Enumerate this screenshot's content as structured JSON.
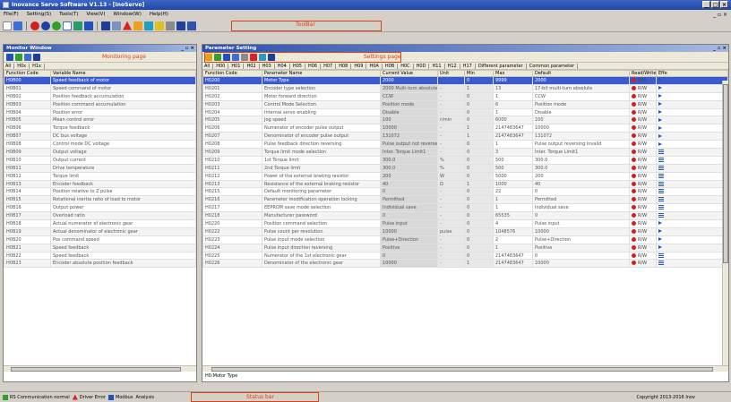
{
  "window": {
    "title": "Inovance Servo Software  V1.13  -  [InoServo]",
    "controls": [
      "_",
      "□",
      "×"
    ]
  },
  "menu": [
    "File(F)",
    "Setting(S)",
    "Tools(T)",
    "View(V)",
    "Window(W)",
    "Help(H)"
  ],
  "toolbar": {
    "annotation": "ToolBar",
    "icons": [
      "new-icon",
      "open-icon",
      "save-icon",
      "connect-icon",
      "disconnect-icon",
      "monitor-icon",
      "oscilloscope-icon",
      "trend-icon",
      "inertia-icon",
      "gain-icon",
      "alarm-icon",
      "jog-icon",
      "tune-icon",
      "io-icon",
      "compare-icon",
      "print-icon",
      "help-icon"
    ]
  },
  "left_panel": {
    "title": "Monitor Window",
    "annotation": "Monitoring page",
    "filter_tabs": [
      "All",
      "H0x",
      "H1x"
    ],
    "columns": [
      "Function Code",
      "Variable Name"
    ],
    "rows": [
      [
        "H0B00",
        "Speed feedback of motor"
      ],
      [
        "H0B01",
        "Speed command of motor"
      ],
      [
        "H0B02",
        "Position feedback accumulation"
      ],
      [
        "H0B03",
        "Position command accumulation"
      ],
      [
        "H0B04",
        "Position error"
      ],
      [
        "H0B05",
        "Mean control error"
      ],
      [
        "H0B06",
        "Torque feedback"
      ],
      [
        "H0B07",
        "DC bus voltage"
      ],
      [
        "H0B08",
        "Control mode DC voltage"
      ],
      [
        "H0B09",
        "Output voltage"
      ],
      [
        "H0B10",
        "Output current"
      ],
      [
        "H0B11",
        "Drive temperature"
      ],
      [
        "H0B12",
        "Torque limit"
      ],
      [
        "H0B13",
        "Encoder feedback"
      ],
      [
        "H0B14",
        "Position relative to Z pulse"
      ],
      [
        "H0B15",
        "Rotational inertia ratio of load to motor"
      ],
      [
        "H0B16",
        "Output power"
      ],
      [
        "H0B17",
        "Overload ratio"
      ],
      [
        "H0B18",
        "Actual numerator of electronic gear"
      ],
      [
        "H0B19",
        "Actual denominator of electronic gear"
      ],
      [
        "H0B20",
        "Pos command speed"
      ],
      [
        "H0B21",
        "Speed feedback"
      ],
      [
        "H0B22",
        "Speed feedback"
      ],
      [
        "H0B23",
        "Encoder absolute position feedback"
      ]
    ]
  },
  "right_panel": {
    "title": "Parameter Setting",
    "annotation": "Settings page",
    "filter_tabs": [
      "All",
      "H00",
      "H01",
      "H02",
      "H03",
      "H04",
      "H05",
      "H06",
      "H07",
      "H08",
      "H09",
      "H0A",
      "H0B",
      "H0C",
      "H0D",
      "H11",
      "H12",
      "H17"
    ],
    "extra_tabs": [
      "Different parameter",
      "Common parameter"
    ],
    "columns": [
      "Function Code",
      "Parameter Name",
      "Current Value",
      "Unit",
      "Min",
      "Max",
      "Default",
      "Read/Write",
      "Effe"
    ],
    "rows": [
      [
        "H0200",
        "Motor Type",
        "2000",
        "",
        "0",
        "9999",
        "2000",
        "R/W",
        "arrow"
      ],
      [
        "H0201",
        "Encoder type selection",
        "2000 Multi-turn absolute",
        "-",
        "1",
        "13",
        "17-bit multi-turn absolute",
        "R/W",
        "arrow"
      ],
      [
        "H0202",
        "Motor forward direction",
        "CCW",
        "-",
        "0",
        "1",
        "CCW",
        "R/W",
        "arrow"
      ],
      [
        "H0203",
        "Control Mode Selection",
        "Position mode",
        "-",
        "0",
        "6",
        "Position mode",
        "R/W",
        "arrow"
      ],
      [
        "H0204",
        "Internal servo enabling",
        "Disable",
        "-",
        "0",
        "1",
        "Disable",
        "R/W",
        "arrow"
      ],
      [
        "H0205",
        "Jog speed",
        "100",
        "r/min",
        "0",
        "6000",
        "100",
        "R/W",
        "arrow"
      ],
      [
        "H0206",
        "Numerator of encoder pulse output",
        "10000",
        "-",
        "1",
        "2147483647",
        "10000",
        "R/W",
        "arrow"
      ],
      [
        "H0207",
        "Denominator of encoder pulse output",
        "131072",
        "-",
        "1",
        "2147483647",
        "131072",
        "R/W",
        "arrow"
      ],
      [
        "H0208",
        "Pulse feedback direction reversing",
        "Pulse output not reversed",
        "-",
        "0",
        "1",
        "Pulse output reversing invalid",
        "R/W",
        "arrow"
      ],
      [
        "H0209",
        "Torque limit mode selection",
        "Inter. Torque Limit1",
        "-",
        "0",
        "3",
        "Inter. Torque Limit1",
        "R/W",
        "bars"
      ],
      [
        "H0210",
        "1st Torque limit",
        "300.0",
        "%",
        "0",
        "500",
        "300.0",
        "R/W",
        "bars"
      ],
      [
        "H0211",
        "2nd Torque limit",
        "300.0",
        "%",
        "0",
        "500",
        "300.0",
        "R/W",
        "bars"
      ],
      [
        "H0212",
        "Power of the external braking resistor",
        "200",
        "W",
        "0",
        "5000",
        "200",
        "R/W",
        "bars"
      ],
      [
        "H0213",
        "Resistance of the external braking resistor",
        "40",
        "Ω",
        "1",
        "1000",
        "40",
        "R/W",
        "bars"
      ],
      [
        "H0215",
        "Default monitoring parameter",
        "0",
        "-",
        "0",
        "22",
        "0",
        "R/W",
        "bars"
      ],
      [
        "H0216",
        "Parameter modification operation locking",
        "Permitted",
        "-",
        "0",
        "1",
        "Permitted",
        "R/W",
        "bars"
      ],
      [
        "H0217",
        "EEPROM save mode selection",
        "Individual save",
        "-",
        "0",
        "1",
        "Individual save",
        "R/W",
        "bars"
      ],
      [
        "H0218",
        "Manufacturer password",
        "0",
        "-",
        "0",
        "65535",
        "0",
        "R/W",
        "bars"
      ],
      [
        "H0220",
        "Position command selection",
        "Pulse input",
        "-",
        "0",
        "4",
        "Pulse input",
        "R/W",
        "arrow"
      ],
      [
        "H0222",
        "Pulse count per revolution",
        "10000",
        "pulse",
        "0",
        "1048576",
        "10000",
        "R/W",
        "arrow"
      ],
      [
        "H0223",
        "Pulse input mode selection",
        "Pulse+Direction",
        "-",
        "0",
        "2",
        "Pulse+Direction",
        "R/W",
        "arrow"
      ],
      [
        "H0224",
        "Pulse input direction reversing",
        "Positive",
        "-",
        "0",
        "1",
        "Positive",
        "R/W",
        "arrow"
      ],
      [
        "H0225",
        "Numerator of the 1st electronic gear",
        "0",
        "-",
        "0",
        "2147483647",
        "0",
        "R/W",
        "bars"
      ],
      [
        "H0226",
        "Denominator of the electronic gear",
        "10000",
        "-",
        "1",
        "2147483647",
        "10000",
        "R/W",
        "bars"
      ]
    ],
    "bottom_label": "H0:Motor Type"
  },
  "statusbar": {
    "items": [
      "RS Communication normal",
      "Driver Error",
      "Modbus",
      "Analysis"
    ],
    "annotation": "Status bar",
    "copyright": "Copyright 2013-2016  Inov"
  }
}
